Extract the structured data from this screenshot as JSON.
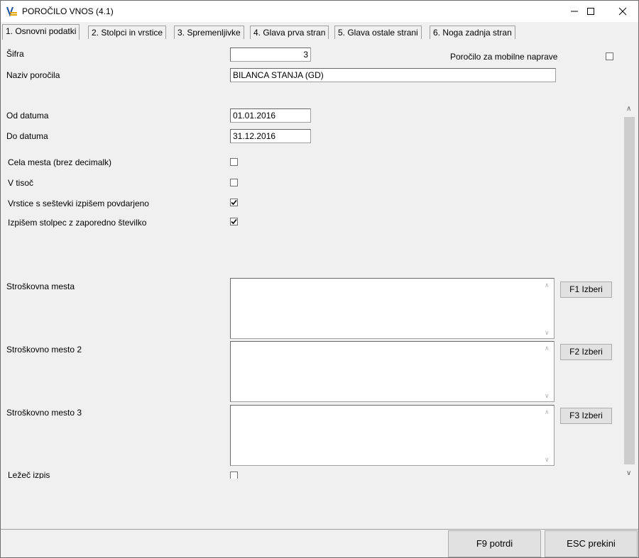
{
  "window": {
    "title": "POROČILO VNOS  (4.1)"
  },
  "tabs": [
    {
      "label": "1. Osnovni podatki"
    },
    {
      "label": "2. Stolpci in vrstice"
    },
    {
      "label": "3. Spremenljivke"
    },
    {
      "label": "4. Glava prva stran"
    },
    {
      "label": "5. Glava ostale strani"
    },
    {
      "label": "6. Noga zadnja stran"
    }
  ],
  "form": {
    "sifra_label": "Šifra",
    "sifra_value": "3",
    "mobile_label": "Poročilo za mobilne naprave",
    "mobile_checked": false,
    "naziv_label": "Naziv poročila",
    "naziv_value": "BILANCA STANJA (GD)",
    "od_label": "Od datuma",
    "od_value": "01.01.2016",
    "do_label": "Do datuma",
    "do_value": "31.12.2016",
    "cela_label": "Cela mesta (brez decimalk)",
    "cela_checked": false,
    "tisoc_label": "V tisoč",
    "tisoc_checked": false,
    "vrstice_label": "Vrstice s seštevki izpišem povdarjeno",
    "vrstice_checked": true,
    "stolpec_label": "Izpišem stolpec z zaporedno številko",
    "stolpec_checked": true,
    "sm1_label": "Stroškovna mesta",
    "sm1_button": "F1 Izberi",
    "sm2_label": "Stroškovno mesto 2",
    "sm2_button": "F2 Izberi",
    "sm3_label": "Stroškovno mesto 3",
    "sm3_button": "F3 Izberi",
    "lezec_label": "Ležeč izpis"
  },
  "footer": {
    "confirm_label": "F9  potrdi",
    "cancel_label": "ESC  prekini"
  }
}
